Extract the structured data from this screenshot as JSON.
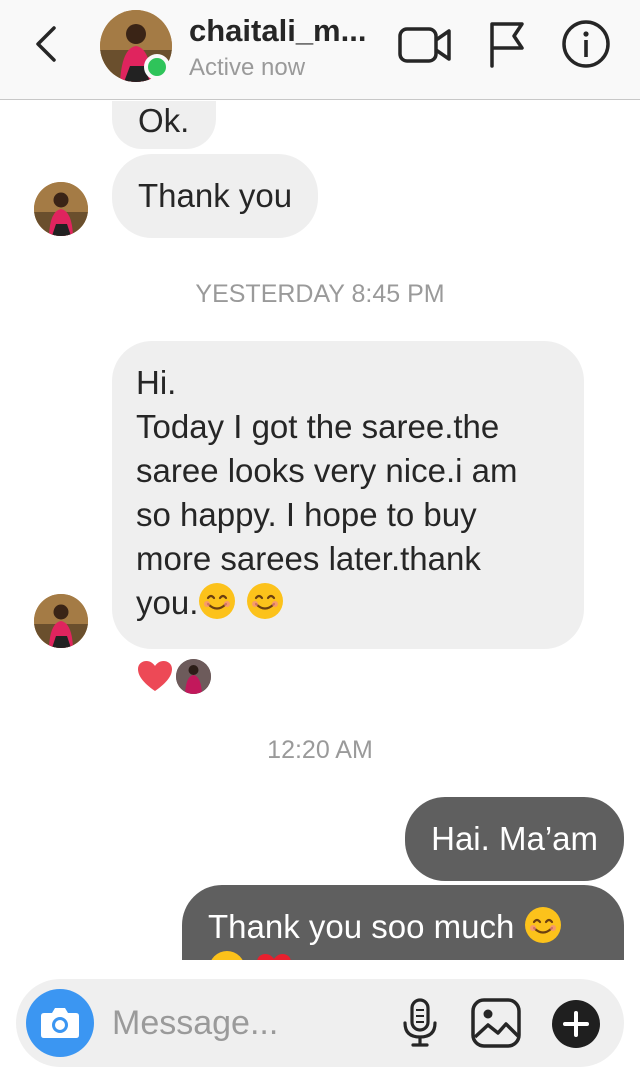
{
  "header": {
    "back_icon": "chevron-left-icon",
    "contact_name": "chaitali_m...",
    "status": "Active now",
    "status_color": "#2fc45a",
    "actions": [
      "video-call-icon",
      "flag-icon",
      "info-icon"
    ]
  },
  "messages": [
    {
      "sender": "contact",
      "text": "Ok."
    },
    {
      "sender": "contact",
      "text": "Thank you"
    },
    {
      "type": "timestamp",
      "text": "YESTERDAY 8:45 PM"
    },
    {
      "sender": "contact",
      "lines": [
        "Hi.",
        "Today I got the saree.the",
        "saree looks very nice.i am",
        "so happy. I hope to buy",
        "more sarees later.thank",
        "you."
      ],
      "emojis": [
        "smiling-face-emoji",
        "smiling-face-emoji"
      ],
      "reaction": "heart"
    },
    {
      "type": "timestamp",
      "text": "12:20 AM"
    },
    {
      "sender": "me",
      "text": "Hai. Ma’am"
    },
    {
      "sender": "me",
      "text": "Thank you soo much",
      "emojis": [
        "smiling-face-emoji",
        "smiling-face-emoji",
        "red-heart-emoji"
      ]
    }
  ],
  "composer": {
    "placeholder": "Message...",
    "camera_icon": "camera-icon",
    "mic_icon": "microphone-icon",
    "gallery_icon": "image-icon",
    "plus_icon": "plus-icon"
  },
  "colors": {
    "incoming_bubble": "#efefef",
    "outgoing_bubble": "#5f5f5f",
    "camera_button": "#3b96f2"
  }
}
